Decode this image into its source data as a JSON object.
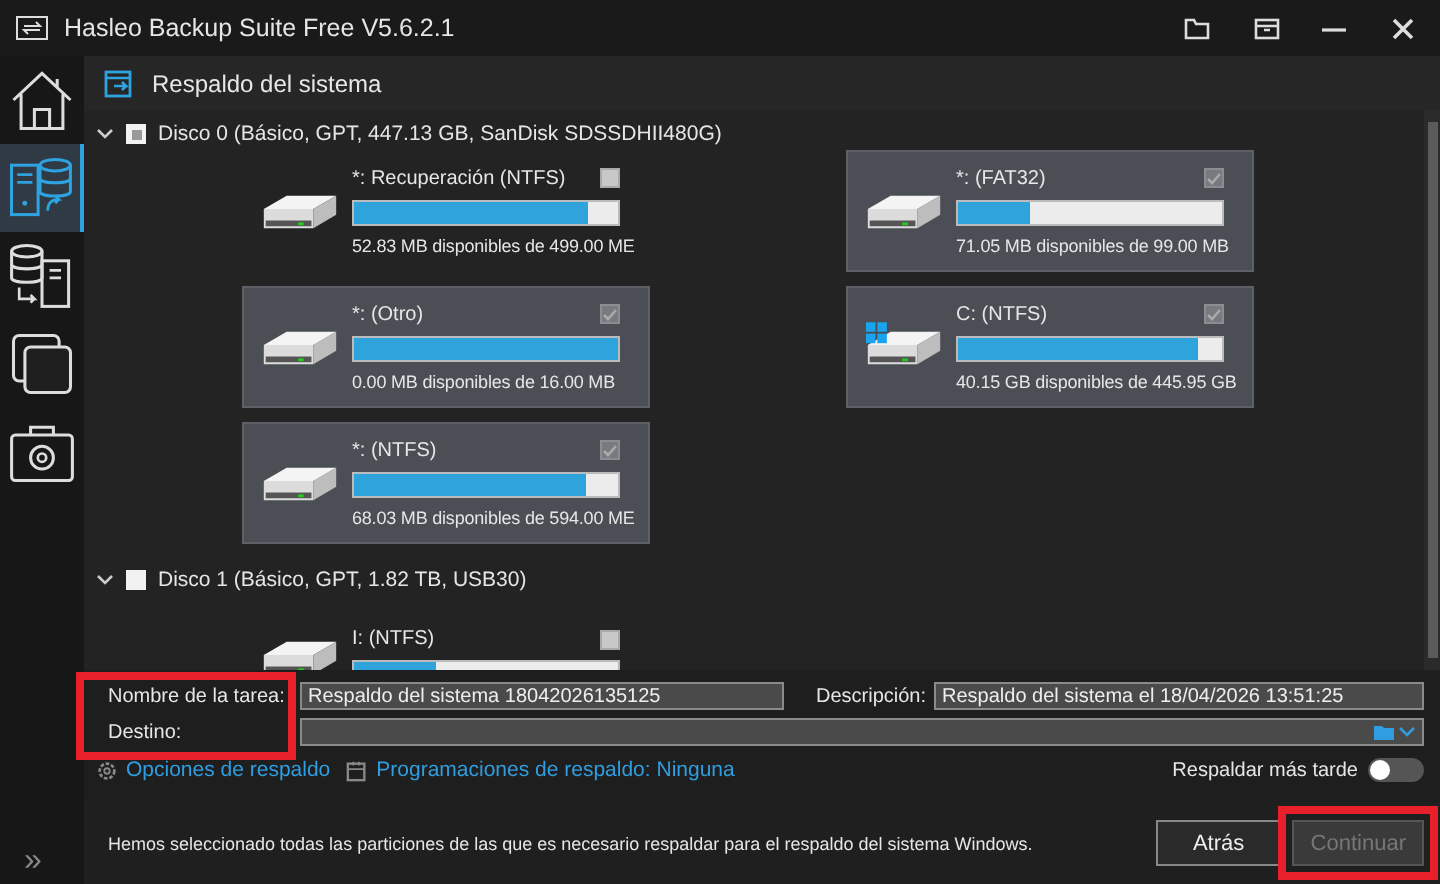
{
  "window": {
    "title": "Hasleo Backup Suite Free V5.6.2.1"
  },
  "sidebar": {
    "items": [
      {
        "selected": false
      },
      {
        "selected": true
      },
      {
        "selected": false
      },
      {
        "selected": false
      },
      {
        "selected": false
      }
    ],
    "expand": "»"
  },
  "header": {
    "title": "Respaldo del sistema"
  },
  "disks": [
    {
      "label": "Disco 0 (Básico, GPT, 447.13 GB,  SanDisk SDSSDHII480G)",
      "expanded": true,
      "partial": true,
      "partitions": [
        {
          "name": "*: Recuperación (NTFS)",
          "checked": false,
          "selected": false,
          "system": false,
          "level": 0.885,
          "free": "52.83 MB disponibles de 499.00 ME"
        },
        {
          "name": "*: (FAT32)",
          "checked": true,
          "selected": true,
          "system": false,
          "level": 0.27,
          "free": "71.05 MB disponibles de 99.00 MB"
        },
        {
          "name": "*: (Otro)",
          "checked": true,
          "selected": true,
          "system": false,
          "level": 1,
          "free": "0.00 MB disponibles de 16.00 MB"
        },
        {
          "name": "C: (NTFS)",
          "checked": true,
          "selected": true,
          "system": true,
          "level": 0.91,
          "free": "40.15 GB disponibles de 445.95 GB"
        },
        {
          "name": "*: (NTFS)",
          "checked": true,
          "selected": true,
          "system": false,
          "level": 0.875,
          "free": "68.03 MB disponibles de 594.00 ME"
        }
      ]
    },
    {
      "label": "Disco 1 (Básico, GPT, 1.82 TB, USB30)",
      "expanded": true,
      "partial": false,
      "partitions": [
        {
          "name": "I: (NTFS)",
          "checked": false,
          "selected": false,
          "system": false,
          "level": 0.31
        }
      ]
    }
  ],
  "form": {
    "highlighted": true,
    "task_label": "Nombre de la tarea:",
    "task_value": "Respaldo del sistema 18042026135125",
    "description_label": "Descripción:",
    "description_value": "Respaldo del sistema el 18/04/2026 13:51:25",
    "destination_label": "Destino:"
  },
  "links": [
    {
      "text": "Opciones de respaldo"
    },
    {
      "text": "Programaciones de respaldo: Ninguna"
    }
  ],
  "later": {
    "label": "Respaldar más tarde",
    "on": false
  },
  "footer": {
    "message": "Hemos seleccionado todas las particiones de las que es necesario respaldar para el respaldo del sistema Windows.",
    "buttons": [
      {
        "label": "Atrás",
        "disabled": false,
        "highlighted": false
      },
      {
        "label": "Continuar",
        "disabled": true,
        "highlighted": true
      }
    ]
  }
}
